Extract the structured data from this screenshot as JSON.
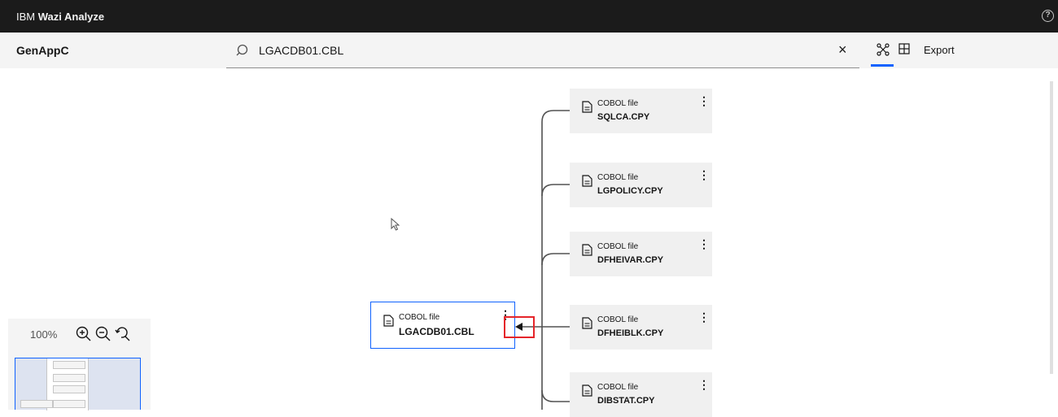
{
  "header": {
    "brand_prefix": "IBM",
    "brand_name": "Wazi Analyze",
    "help_icon": "help-icon"
  },
  "toolbar": {
    "project": "GenAppC",
    "search": {
      "value": "LGACDB01.CBL",
      "icon": "search-icon",
      "clear_icon": "close-icon"
    },
    "views": [
      {
        "name": "graph-view-icon",
        "active": true
      },
      {
        "name": "table-view-icon",
        "active": false
      }
    ],
    "export_label": "Export",
    "accent_color": "#0f62fe"
  },
  "graph": {
    "center": {
      "type": "COBOL file",
      "name": "LGACDB01.CBL"
    },
    "dependencies": [
      {
        "type": "COBOL file",
        "name": "SQLCA.CPY"
      },
      {
        "type": "COBOL file",
        "name": "LGPOLICY.CPY"
      },
      {
        "type": "COBOL file",
        "name": "DFHEIVAR.CPY"
      },
      {
        "type": "COBOL file",
        "name": "DFHEIBLK.CPY"
      },
      {
        "type": "COBOL file",
        "name": "DIBSTAT.CPY"
      }
    ],
    "highlight_color": "#e5252a"
  },
  "zoom": {
    "level": "100%",
    "controls": [
      "zoom-in-icon",
      "zoom-out-icon",
      "reset-zoom-icon"
    ]
  }
}
